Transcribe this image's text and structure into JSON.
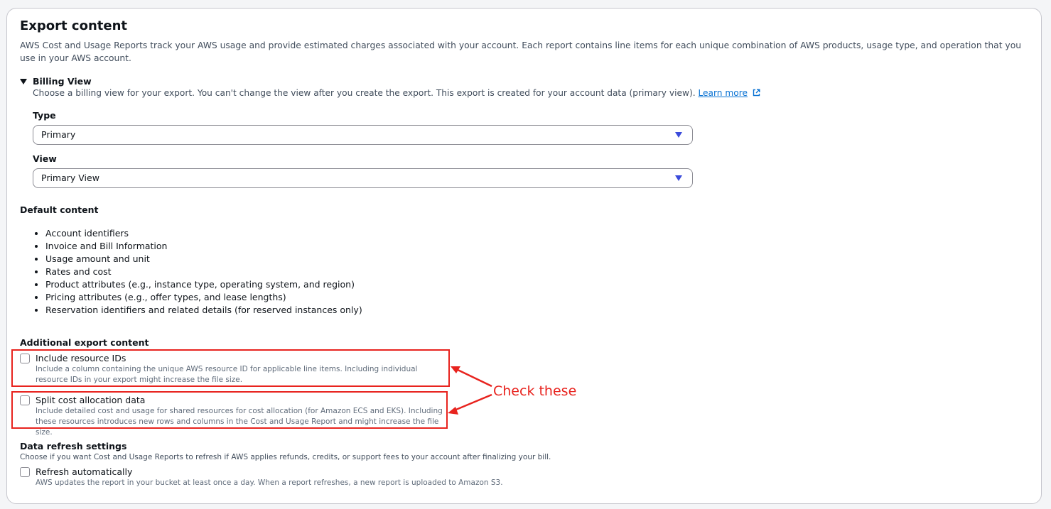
{
  "section": {
    "title": "Export content",
    "description": "AWS Cost and Usage Reports track your AWS usage and provide estimated charges associated with your account. Each report contains line items for each unique combination of AWS products, usage type, and operation that you use in your AWS account."
  },
  "billing_view": {
    "heading": "Billing View",
    "description": "Choose a billing view for your export. You can't change the view after you create the export. This export is created for your account data (primary view).",
    "learn_more": "Learn more",
    "type_label": "Type",
    "type_value": "Primary",
    "view_label": "View",
    "view_value": "Primary View"
  },
  "default_content": {
    "heading": "Default content",
    "items": [
      "Account identifiers",
      "Invoice and Bill Information",
      "Usage amount and unit",
      "Rates and cost",
      "Product attributes (e.g., instance type, operating system, and region)",
      "Pricing attributes (e.g., offer types, and lease lengths)",
      "Reservation identifiers and related details (for reserved instances only)"
    ]
  },
  "additional": {
    "heading": "Additional export content",
    "resource_ids": {
      "label": "Include resource IDs",
      "description": "Include a column containing the unique AWS resource ID for applicable line items. Including individual resource IDs in your export might increase the file size."
    },
    "split_cost": {
      "label": "Split cost allocation data",
      "description": "Include detailed cost and usage for shared resources for cost allocation (for Amazon ECS and EKS). Including these resources introduces new rows and columns in the Cost and Usage Report and might increase the file size."
    }
  },
  "refresh": {
    "heading": "Data refresh settings",
    "description": "Choose if you want Cost and Usage Reports to refresh if AWS applies refunds, credits, or support fees to your account after finalizing your bill.",
    "auto_label": "Refresh automatically",
    "auto_description": "AWS updates the report in your bucket at least once a day. When a report refreshes, a new report is uploaded to Amazon S3."
  },
  "annotation": {
    "text": "Check these",
    "color": "#e8231e"
  },
  "colors": {
    "link": "#0972d3",
    "dropdown_arrow": "#3b4bdb"
  }
}
